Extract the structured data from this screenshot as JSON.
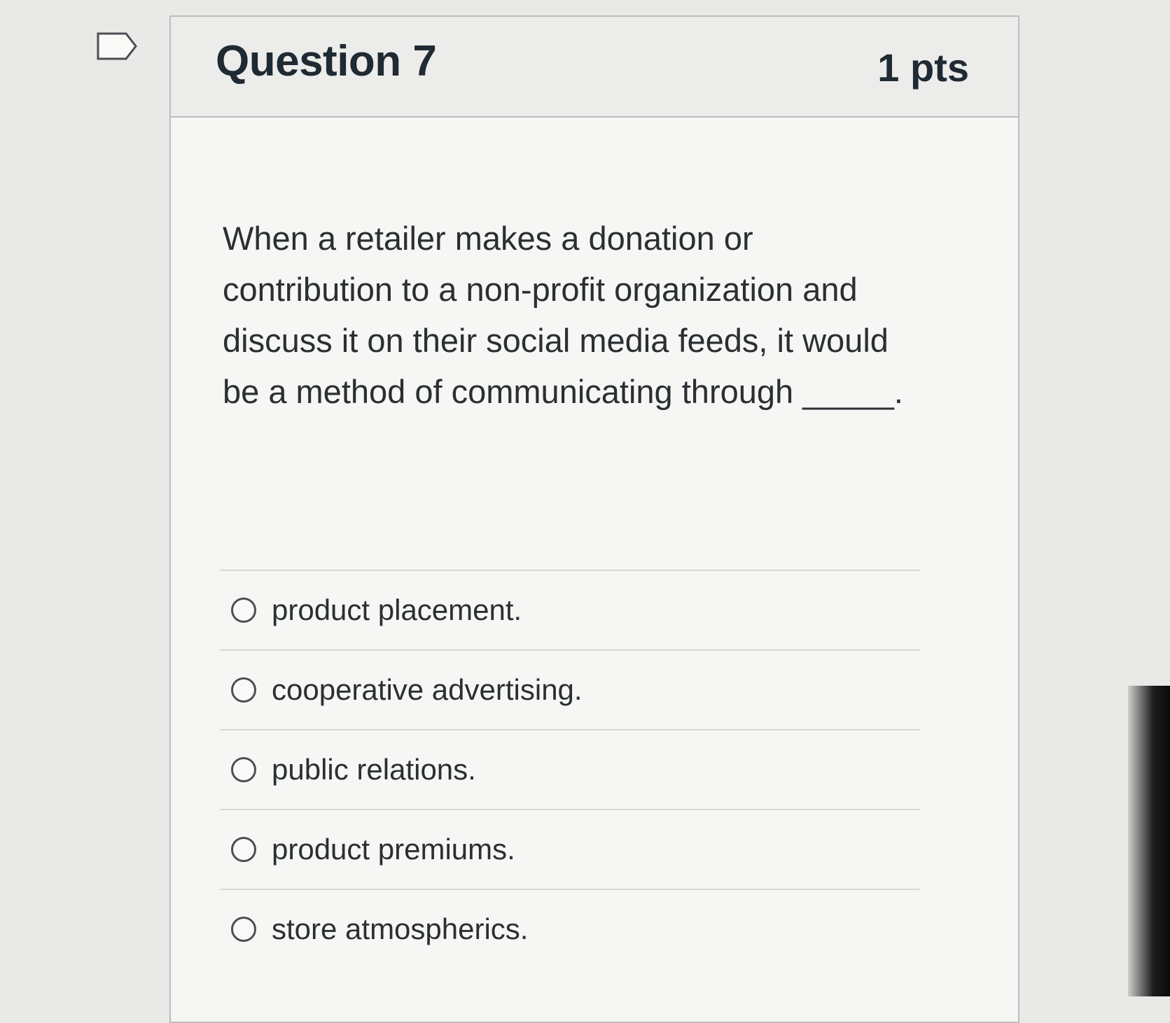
{
  "question": {
    "title": "Question 7",
    "points": "1 pts",
    "text": "When a retailer makes a donation or contribution to a non-profit organization and discuss it on their social media feeds, it would be a method of communicating through _____."
  },
  "answers": [
    {
      "label": "product placement."
    },
    {
      "label": "cooperative advertising."
    },
    {
      "label": "public relations."
    },
    {
      "label": "product premiums."
    },
    {
      "label": "store atmospherics."
    }
  ],
  "icons": {
    "flag": "flag-outline-icon",
    "radio": "radio-unselected-icon"
  },
  "colors": {
    "text": "#2a2f33",
    "border": "#bdbdbd",
    "background": "#f6f6f4"
  }
}
